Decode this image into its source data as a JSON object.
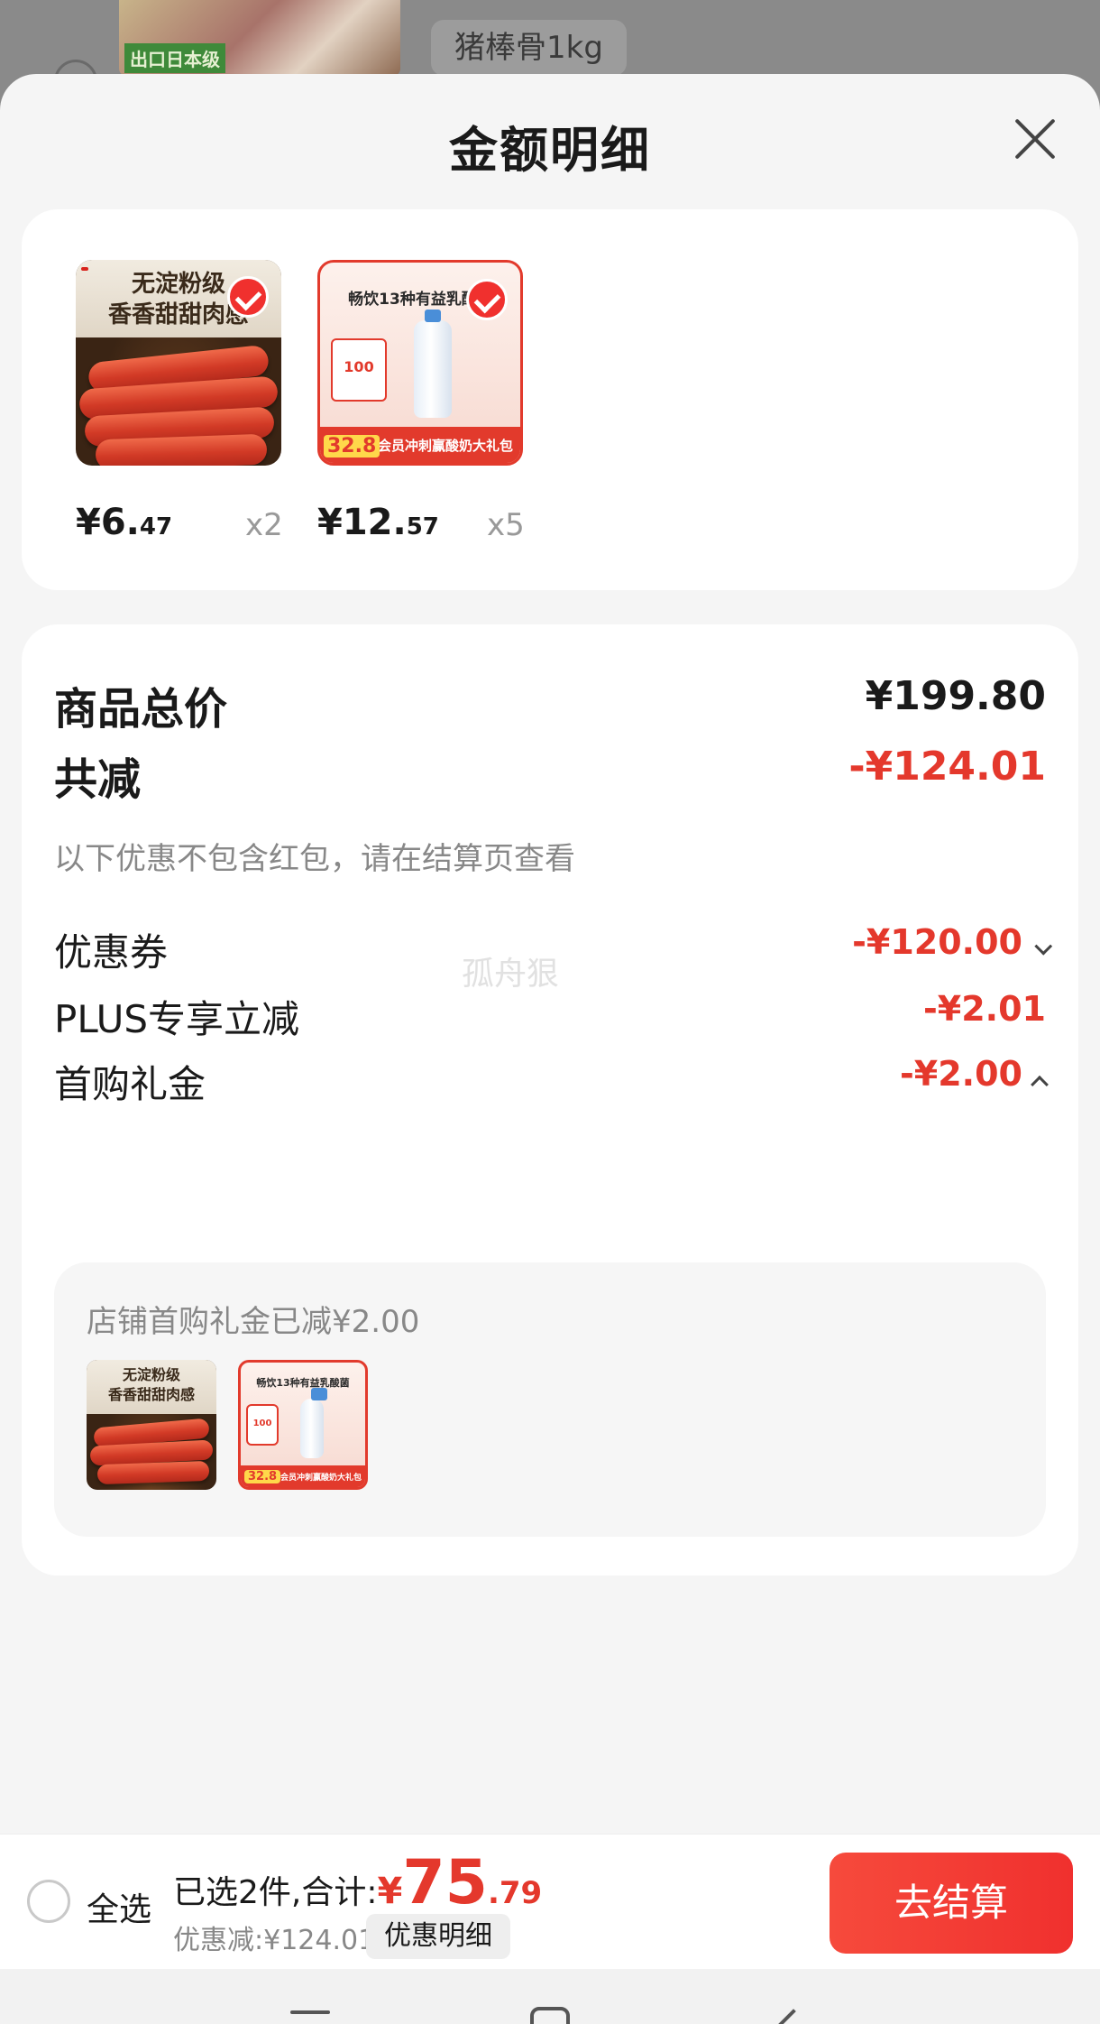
{
  "background_page": {
    "product_tag": "出口日本级",
    "spec_label": "猪棒骨1kg"
  },
  "sheet": {
    "title": "金额明细",
    "products": [
      {
        "image_caption_line1": "无淀粉级",
        "image_caption_line2": "香香甜甜肉感",
        "price_int": "¥6.",
        "price_dec": "47",
        "quantity": "x2"
      },
      {
        "image_caption_line1": "畅饮13种有益乳酸菌",
        "image_banner": "会员冲刺赢酸奶大礼包",
        "image_price": "32.8",
        "image_coupon": "100",
        "price_int": "¥12.",
        "price_dec": "57",
        "quantity": "x5"
      }
    ],
    "summary": {
      "total_label": "商品总价",
      "total_value": "¥199.80",
      "reduce_label": "共减",
      "reduce_value": "-¥124.01",
      "note": "以下优惠不包含红包，请在结算页查看",
      "watermark": "孤舟狠",
      "coupon_label": "优惠券",
      "coupon_value": "-¥120.00",
      "plus_label": "PLUS专享立减",
      "plus_value": "-¥2.01",
      "gift_label": "首购礼金",
      "gift_value": "-¥2.00",
      "gift_detail": "店铺首购礼金已减¥2.00"
    }
  },
  "bottom_bar": {
    "select_all": "全选",
    "selected_prefix": "已选2件,合计:",
    "yen": "¥",
    "total_int": "75",
    "total_dec": ".79",
    "discount_text": "优惠减:¥124.01",
    "detail_button": "优惠明细",
    "checkout_button": "去结算"
  },
  "colors": {
    "accent_red": "#e4382c",
    "checkout_red": "#f0302e"
  },
  "icons": [
    "close-icon",
    "check-icon",
    "chevron-down-icon",
    "chevron-up-icon",
    "radio-icon",
    "menu-icon",
    "home-icon",
    "back-icon"
  ]
}
